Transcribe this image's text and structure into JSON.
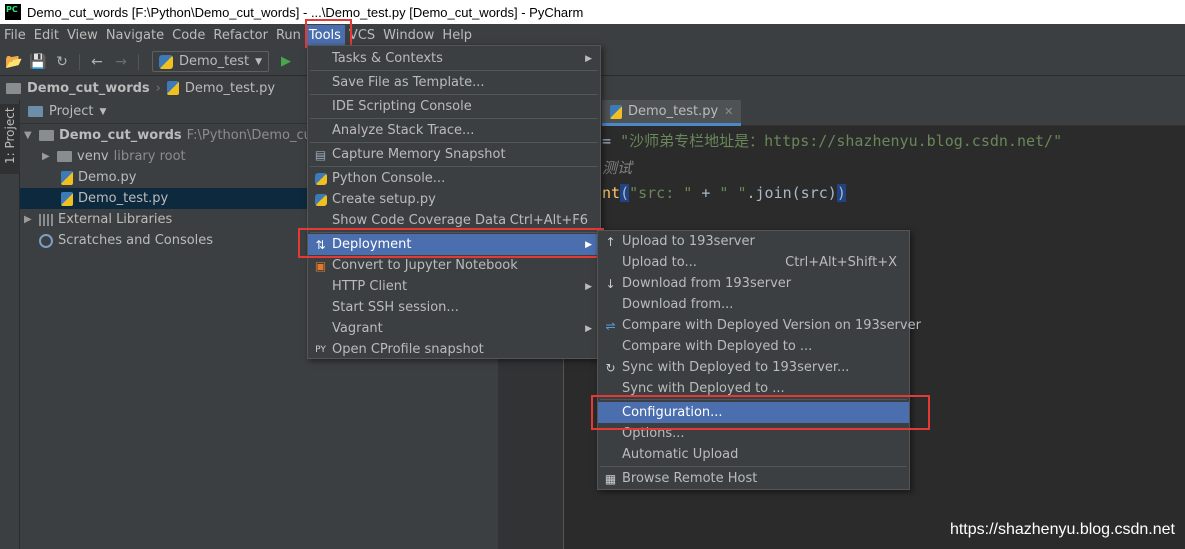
{
  "window": {
    "app_icon_text": "PC",
    "title": "Demo_cut_words [F:\\Python\\Demo_cut_words] - ...\\Demo_test.py [Demo_cut_words] - PyCharm"
  },
  "menubar": {
    "items": [
      "File",
      "Edit",
      "View",
      "Navigate",
      "Code",
      "Refactor",
      "Run",
      "Tools",
      "VCS",
      "Window",
      "Help"
    ],
    "active": "Tools"
  },
  "toolbar": {
    "run_config": "Demo_test"
  },
  "breadcrumb": {
    "project": "Demo_cut_words",
    "file": "Demo_test.py"
  },
  "sidestrip": {
    "project_tab": "1: Project"
  },
  "project_panel": {
    "header": "Project",
    "tree": [
      {
        "label": "Demo_cut_words",
        "extra": "F:\\Python\\Demo_cut_wo",
        "bold": true,
        "arrow": "▼",
        "icon": "folder-icon"
      },
      {
        "label": "venv",
        "extra": "library root",
        "bold": false,
        "arrow": "▶",
        "icon": "folder-icon"
      },
      {
        "label": "Demo.py",
        "extra": "",
        "bold": false,
        "arrow": "",
        "icon": "python-file-icon"
      },
      {
        "label": "Demo_test.py",
        "extra": "",
        "bold": false,
        "arrow": "",
        "icon": "python-file-icon",
        "selected": true
      },
      {
        "label": "External Libraries",
        "extra": "",
        "bold": false,
        "arrow": "▶",
        "icon": "library-icon"
      },
      {
        "label": "Scratches and Consoles",
        "extra": "",
        "bold": false,
        "arrow": "",
        "icon": "scratch-icon"
      }
    ]
  },
  "editor": {
    "tab": "Demo_test.py",
    "line1_op": "= ",
    "line1_str": "\"沙师弟专栏地址是：https://shazhenyu.blog.csdn.net/\"",
    "line2_cmt": "测试",
    "line3_fn": "nt",
    "line3_paren": "(",
    "line3_str1": "\"src: \"",
    "line3_plus": " + ",
    "line3_str2": "\" \"",
    "line3_rest": ".join(src)",
    "line3_close": ")"
  },
  "tools_menu": {
    "items": [
      {
        "label": "Tasks & Contexts",
        "shortcut": "",
        "submenu": true,
        "icon": ""
      },
      {
        "label": "Save File as Template...",
        "shortcut": "",
        "submenu": false,
        "icon": ""
      },
      {
        "label": "IDE Scripting Console",
        "shortcut": "",
        "submenu": false,
        "icon": ""
      },
      {
        "label": "Analyze Stack Trace...",
        "shortcut": "",
        "submenu": false,
        "icon": ""
      },
      {
        "label": "Capture Memory Snapshot",
        "shortcut": "",
        "submenu": false,
        "icon": "memory-snapshot-icon"
      },
      {
        "label": "Python Console...",
        "shortcut": "",
        "submenu": false,
        "icon": "python-console-icon"
      },
      {
        "label": "Create setup.py",
        "shortcut": "",
        "submenu": false,
        "icon": "python-icon"
      },
      {
        "label": "Show Code Coverage Data",
        "shortcut": "Ctrl+Alt+F6",
        "submenu": false,
        "icon": ""
      },
      {
        "label": "Deployment",
        "shortcut": "",
        "submenu": true,
        "icon": "deployment-icon",
        "highlight": true
      },
      {
        "label": "Convert to Jupyter Notebook",
        "shortcut": "",
        "submenu": false,
        "icon": "jupyter-icon"
      },
      {
        "label": "HTTP Client",
        "shortcut": "",
        "submenu": true,
        "icon": ""
      },
      {
        "label": "Start SSH session...",
        "shortcut": "",
        "submenu": false,
        "icon": ""
      },
      {
        "label": "Vagrant",
        "shortcut": "",
        "submenu": true,
        "icon": ""
      },
      {
        "label": "Open CProfile snapshot",
        "shortcut": "",
        "submenu": false,
        "icon": "cprofile-icon"
      }
    ]
  },
  "deployment_menu": {
    "items": [
      {
        "label": "Upload to 193server",
        "shortcut": "",
        "icon": "upload-icon"
      },
      {
        "label": "Upload to...",
        "shortcut": "Ctrl+Alt+Shift+X",
        "icon": ""
      },
      {
        "label": "Download from 193server",
        "shortcut": "",
        "icon": "download-icon"
      },
      {
        "label": "Download from...",
        "shortcut": "",
        "icon": ""
      },
      {
        "label": "Compare with Deployed Version on 193server",
        "shortcut": "",
        "icon": "compare-icon"
      },
      {
        "label": "Compare with Deployed to ...",
        "shortcut": "",
        "icon": ""
      },
      {
        "label": "Sync with Deployed to 193server...",
        "shortcut": "",
        "icon": "sync-icon"
      },
      {
        "label": "Sync with Deployed to ...",
        "shortcut": "",
        "icon": ""
      },
      {
        "label": "Configuration...",
        "shortcut": "",
        "icon": "",
        "highlight": true
      },
      {
        "label": "Options...",
        "shortcut": "",
        "icon": ""
      },
      {
        "label": "Automatic Upload",
        "shortcut": "",
        "icon": ""
      },
      {
        "label": "Browse Remote Host",
        "shortcut": "",
        "icon": "remote-host-icon"
      }
    ]
  },
  "watermark": "https://shazhenyu.blog.csdn.net",
  "colors": {
    "highlight": "#4b6eaf",
    "annotation_red": "#e53935",
    "panel_bg": "#3c3f41",
    "editor_bg": "#2b2b2b"
  }
}
